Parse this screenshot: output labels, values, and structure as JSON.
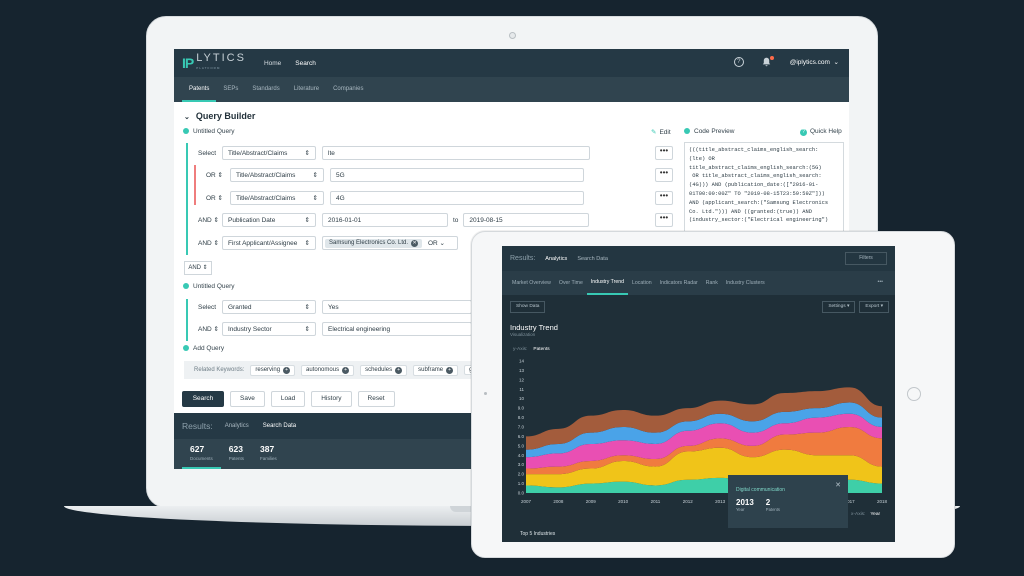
{
  "laptop": {
    "logo_mark": "IP",
    "logo_text": "LYTICS",
    "logo_sub": "PLATFORM",
    "nav": [
      {
        "label": "Home"
      },
      {
        "label": "Search"
      }
    ],
    "help_icon_glyph": "?",
    "user": "@iplytics.com",
    "subnav": [
      {
        "label": "Patents"
      },
      {
        "label": "SEPs"
      },
      {
        "label": "Standards"
      },
      {
        "label": "Literature"
      },
      {
        "label": "Companies"
      }
    ],
    "query_builder_title": "Query Builder",
    "query1_title": "Untitled Query",
    "edit_label": "Edit",
    "code_preview_label": "Code Preview",
    "quick_help_label": "Quick Help",
    "rows": [
      {
        "op": "Select",
        "field": "Title/Abstract/Claims",
        "value": "lte"
      },
      {
        "op": "OR",
        "field": "Title/Abstract/Claims",
        "value": "5G"
      },
      {
        "op": "OR",
        "field": "Title/Abstract/Claims",
        "value": "4G"
      },
      {
        "op": "AND",
        "field": "Publication Date",
        "value": "2016-01-01",
        "to_label": "to",
        "value2": "2019-08-15"
      },
      {
        "op": "AND",
        "field": "First Applicant/Assignee",
        "chip": "Samsung Electronics Co. Ltd.",
        "op2": "OR"
      }
    ],
    "and_label": "AND",
    "query2_title": "Untitled Query",
    "rows2": [
      {
        "op": "Select",
        "field": "Granted",
        "value": "Yes"
      },
      {
        "op": "AND",
        "field": "Industry Sector",
        "value": "Electrical engineering"
      }
    ],
    "add_query_label": "Add Query",
    "related_label": "Related Keywords:",
    "keywords": [
      "reserving",
      "autonomous",
      "schedules",
      "subframe"
    ],
    "keyword_trunc": "gr",
    "buttons": [
      "Search",
      "Save",
      "Load",
      "History",
      "Reset"
    ],
    "code_lines": [
      "(((title_abstract_claims_english_search:",
      "(lte) OR",
      "title_abstract_claims_english_search:(5G)",
      " OR title_abstract_claims_english_search:",
      "(4G))) AND (publication_date:([\"2016-01-",
      "01T00:00:00Z\" TO \"2019-08-15T23:59:59Z\"]))",
      "AND (applicant_search:(\"Samsung Electronics",
      "Co. Ltd.\"))) AND ((granted:(true)) AND",
      "(industry_sector:(\"Electrical engineering\")"
    ],
    "results_label": "Results:",
    "results_tabs": [
      "Analytics",
      "Search Data"
    ],
    "stats": [
      {
        "value": "627",
        "label": "Documents"
      },
      {
        "value": "623",
        "label": "Patents"
      },
      {
        "value": "387",
        "label": "Families"
      }
    ]
  },
  "tablet": {
    "results_label": "Results:",
    "tabs": [
      "Analytics",
      "Search Data"
    ],
    "filters_label": "Filters",
    "subtabs": [
      "Market Overview",
      "Over Time",
      "Industry Trend",
      "Location",
      "Indicators Radar",
      "Rank",
      "Industry Clusters"
    ],
    "more_glyph": "•••",
    "show_data_label": "Show Data",
    "settings_label": "Settings ▾",
    "export_label": "Export ▾",
    "chart_title": "Industry Trend",
    "chart_subtitle": "Visualization",
    "y_axis_label": "y-Axis:",
    "y_axis_value": "Patents",
    "x_axis_label": "x-Axis:",
    "x_axis_value": "Year",
    "tooltip": {
      "title": "Digital communication",
      "year": "2013",
      "year_label": "Year",
      "patents": "2",
      "patents_label": "Patents"
    },
    "top5_label": "Top 5 Industries"
  },
  "chart_data": {
    "type": "area",
    "title": "Industry Trend",
    "subtitle": "Visualization",
    "ylabel": "Patents",
    "xlabel": "Year",
    "x": [
      2007,
      2008,
      2009,
      2010,
      2011,
      2012,
      2013,
      2014,
      2015,
      2016,
      2017,
      2018
    ],
    "y_ticks": [
      "0.0",
      "1.0",
      "2.0",
      "3.0",
      "4.0",
      "5.0",
      "6.0",
      "7.0",
      "8.0",
      "9.0",
      "10",
      "11",
      "12",
      "13",
      "14"
    ],
    "ylim": [
      0,
      14
    ],
    "series": [
      {
        "color": "#3ecfa8",
        "values": [
          0.8,
          0.6,
          1.0,
          1.2,
          0.8,
          1.4,
          1.6,
          1.2,
          1.8,
          1.6,
          1.4,
          1.0
        ]
      },
      {
        "color": "#f0c419",
        "values": [
          1.2,
          1.4,
          1.6,
          2.2,
          2.0,
          3.0,
          3.2,
          2.6,
          2.8,
          2.4,
          2.6,
          1.8
        ]
      },
      {
        "color": "#f07b3f",
        "values": [
          0.6,
          0.8,
          0.8,
          0.6,
          0.8,
          0.6,
          1.0,
          1.2,
          1.6,
          2.4,
          3.0,
          3.0
        ]
      },
      {
        "color": "#e94fb3",
        "values": [
          1.2,
          1.4,
          1.8,
          1.6,
          1.6,
          1.6,
          1.6,
          1.4,
          1.2,
          1.6,
          1.4,
          1.2
        ]
      },
      {
        "color": "#4aa3e8",
        "values": [
          0.8,
          1.0,
          1.2,
          1.4,
          1.2,
          1.0,
          1.0,
          1.2,
          1.2,
          1.0,
          1.2,
          1.0
        ]
      },
      {
        "color": "#a35c3c",
        "values": [
          1.4,
          1.6,
          1.8,
          1.8,
          1.8,
          1.4,
          1.4,
          1.8,
          2.0,
          1.8,
          1.6,
          1.2
        ]
      }
    ]
  },
  "colors": {
    "accent": "#38c9b4",
    "navy": "#253945"
  }
}
